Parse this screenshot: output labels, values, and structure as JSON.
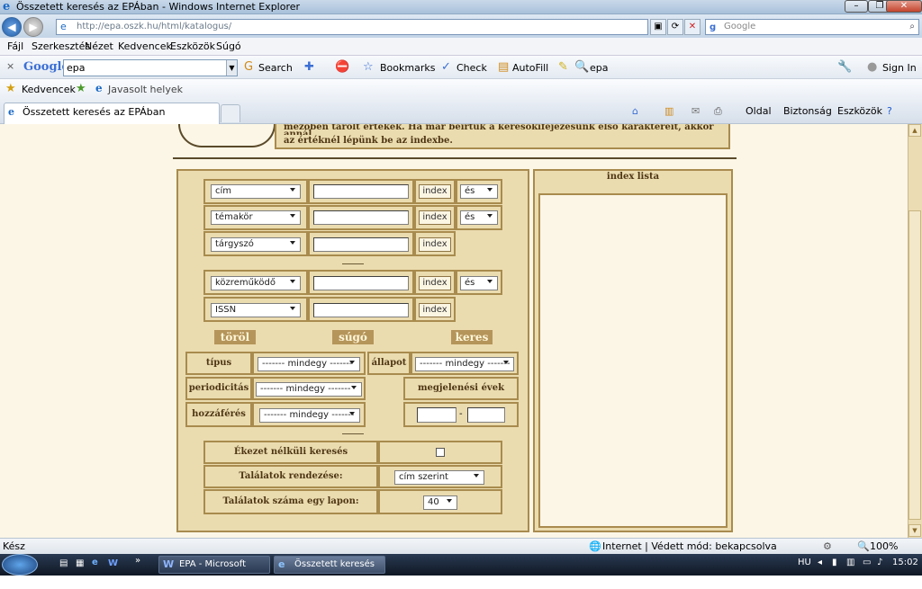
{
  "window": {
    "title": "Összetett keresés az EPÁban - Windows Internet Explorer"
  },
  "address": {
    "url": "http://epa.oszk.hu/html/katalogus/",
    "search_placeholder": "Google"
  },
  "menu": [
    "Fájl",
    "Szerkesztés",
    "Nézet",
    "Kedvencek",
    "Eszközök",
    "Súgó"
  ],
  "google_toolbar": {
    "logo": "Google",
    "query": "epa",
    "search": "Search",
    "bookmarks": "Bookmarks",
    "check": "Check",
    "autofill": "AutoFill",
    "epa": "epa",
    "signin": "Sign In"
  },
  "favorites": {
    "label": "Kedvencek",
    "suggested": "Javasolt helyek"
  },
  "tab": {
    "title": "Összetett keresés az EPÁban"
  },
  "commandbar": {
    "page": "Oldal",
    "security": "Biztonság",
    "tools": "Eszközök"
  },
  "help_text": {
    "line1": "mezőben tárolt értékek. Ha már beírtuk a keresőkifejezésünk első karaktereit, akkor annál",
    "line2": "az értéknél lépünk be az indexbe."
  },
  "form": {
    "rows": [
      {
        "field": "cím",
        "index": "index",
        "op": "és"
      },
      {
        "field": "témakör",
        "index": "index",
        "op": "és"
      },
      {
        "field": "tárgyszó",
        "index": "index"
      },
      {
        "field": "közreműködő",
        "index": "index",
        "op": "és"
      },
      {
        "field": "ISSN",
        "index": "index"
      }
    ],
    "clear": "töröl",
    "help": "súgó",
    "search": "keres",
    "type_label": "típus",
    "type_value": "------- mindegy -------",
    "state_label": "állapot",
    "state_value": "------- mindegy -------",
    "period_label": "periodicitás",
    "period_value": "------- mindegy -------",
    "years_label": "megjelenési évek",
    "years_sep": "-",
    "access_label": "hozzáférés",
    "access_value": "------- mindegy -------",
    "accent_label": "Ékezet nélküli keresés",
    "sort_label": "Találatok rendezése:",
    "sort_value": "cím szerint",
    "per_page_label": "Találatok száma egy lapon:",
    "per_page_value": "40"
  },
  "index_panel": {
    "title": "index lista"
  },
  "status": {
    "left": "Kész",
    "zone": "Internet | Védett mód: bekapcsolva",
    "zoom": "100%"
  },
  "taskbar": {
    "task1": "EPA - Microsoft Word",
    "task2": "Összetett keresés az ...",
    "lang": "HU",
    "clock": "15:02"
  }
}
